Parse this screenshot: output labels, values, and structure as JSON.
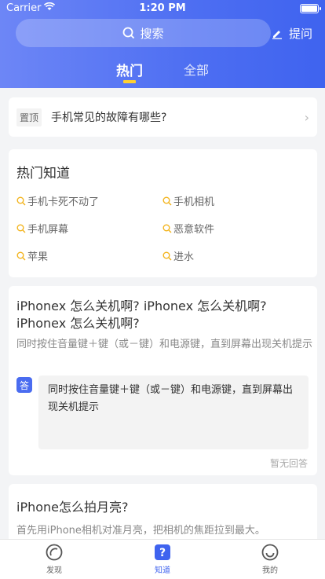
{
  "status_bar": {
    "carrier": "Carrier",
    "time": "1:20 PM"
  },
  "header": {
    "search_placeholder": "搜索",
    "ask_label": "提问",
    "tabs": [
      {
        "label": "热门",
        "active": true
      },
      {
        "label": "全部",
        "active": false
      }
    ]
  },
  "pinned": {
    "tag": "置顶",
    "question": "手机常见的故障有哪些?"
  },
  "hot_knowledge": {
    "title": "热门知道",
    "keywords": [
      "手机卡死不动了",
      "手机相机",
      "手机屏幕",
      "恶意软件",
      "苹果",
      "进水"
    ]
  },
  "questions": [
    {
      "title": "iPhonex 怎么关机啊? iPhonex 怎么关机啊? iPhonex 怎么关机啊?",
      "description": "同时按住音量键＋键（或－键）和电源键，直到屏幕出现关机提示",
      "answer_badge": "答",
      "answer": "同时按住音量键＋键（或－键）和电源键，直到屏幕出现关机提示",
      "status": "暂无回答"
    },
    {
      "title": "iPhone怎么拍月亮?",
      "description": "首先用iPhone相机对准月亮，把相机的焦距拉到最大。"
    }
  ],
  "tab_bar": [
    {
      "label": "发现",
      "icon": "discover-icon",
      "active": false
    },
    {
      "label": "知道",
      "icon": "question-icon",
      "active": true
    },
    {
      "label": "我的",
      "icon": "smiley-icon",
      "active": false
    }
  ],
  "colors": {
    "accent": "#3f63ef",
    "highlight": "#ffd02f"
  }
}
